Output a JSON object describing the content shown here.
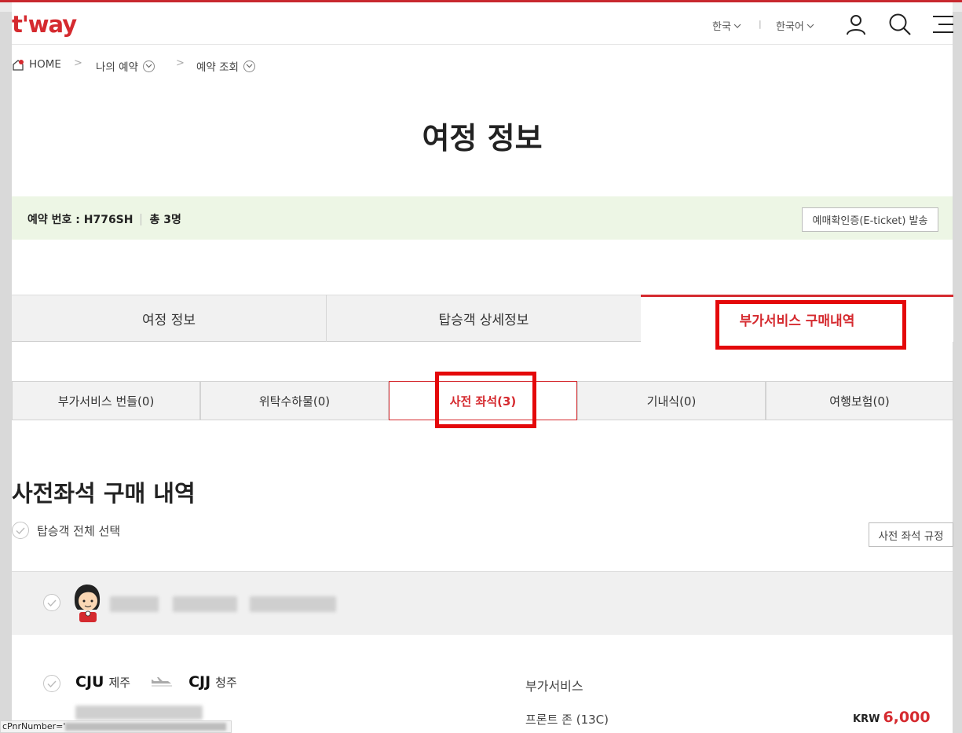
{
  "header": {
    "logo": "t'way",
    "region": "한국",
    "language": "한국어",
    "icons": [
      "user-icon",
      "search-icon",
      "menu-icon"
    ]
  },
  "breadcrumb": {
    "home": "HOME",
    "level1": "나의 예약",
    "level2": "예약 조회"
  },
  "page_title": "여정 정보",
  "booking": {
    "number_label": "예약 번호 : H776SH",
    "pax_label": "총 3명",
    "eticket_button": "예매확인증(E-ticket) 발송"
  },
  "main_tabs": [
    {
      "label": "여정 정보",
      "active": false
    },
    {
      "label": "탑승객 상세정보",
      "active": false
    },
    {
      "label": "부가서비스 구매내역",
      "active": true
    }
  ],
  "sub_tabs": [
    {
      "label": "부가서비스 번들(0)",
      "active": false
    },
    {
      "label": "위탁수하물(0)",
      "active": false
    },
    {
      "label": "사전 좌석(3)",
      "active": true
    },
    {
      "label": "기내식(0)",
      "active": false
    },
    {
      "label": "여행보험(0)",
      "active": false
    }
  ],
  "section": {
    "title": "사전좌석 구매 내역",
    "select_all": "탑승객 전체 선택",
    "rule_button": "사전 좌석 규정"
  },
  "segment": {
    "from_code": "CJU",
    "from_city": "제주",
    "to_code": "CJJ",
    "to_city": "청주",
    "service_label": "부가서비스",
    "seat": "프론트 존 (13C)",
    "currency": "KRW",
    "price": "6,000"
  },
  "statusbar": {
    "text": "cPnrNumber='"
  },
  "colors": {
    "brand": "#d52a2f",
    "highlight": "#e4080a",
    "booking_bar": "#edf6e5"
  }
}
